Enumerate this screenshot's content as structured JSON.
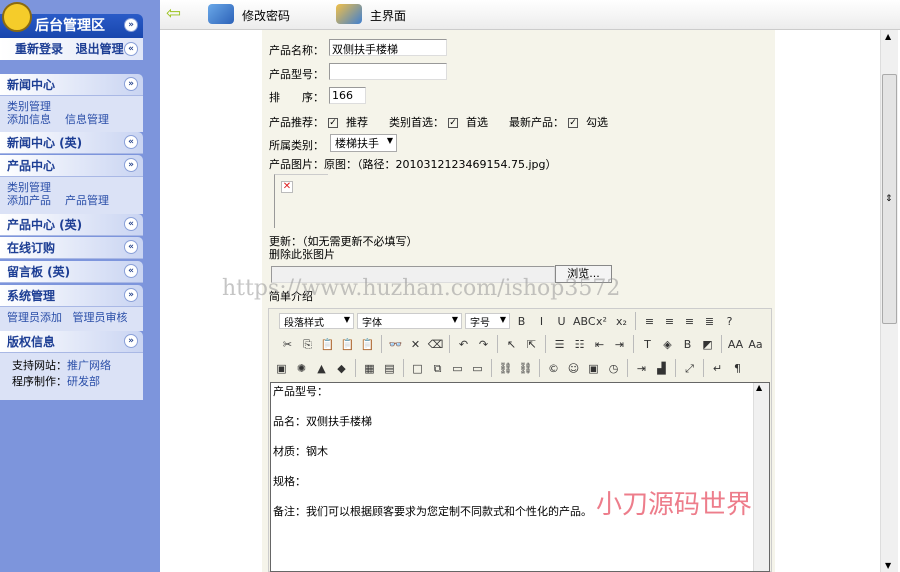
{
  "sidebar": {
    "title": "后台管理区",
    "relogin": "重新登录",
    "logout": "退出管理",
    "sections": [
      {
        "label": "新闻中心",
        "links": [
          "类别管理",
          "添加信息",
          "信息管理"
        ]
      },
      {
        "label": "新闻中心 (英)"
      },
      {
        "label": "产品中心",
        "links": [
          "类别管理",
          "添加产品",
          "产品管理"
        ]
      },
      {
        "label": "产品中心 (英)"
      },
      {
        "label": "在线订购"
      },
      {
        "label": "留言板 (英)"
      },
      {
        "label": "系统管理",
        "links": [
          "管理员添加",
          "管理员审核"
        ]
      },
      {
        "label": "版权信息",
        "links": [
          "支持网站：",
          "推广网络",
          "程序制作：",
          "研发部"
        ]
      }
    ]
  },
  "topbar": {
    "change_password": "修改密码",
    "main": "主界面"
  },
  "form": {
    "name_label": "产品名称：",
    "name_value": "双侧扶手楼梯",
    "model_label": "产品型号：",
    "model_value": "",
    "order_label": "排　　序：",
    "order_value": "166",
    "recommend_label": "产品推荐：",
    "recommend_opt": "推荐",
    "catfirst_label": "类别首选：",
    "catfirst_opt": "首选",
    "newest_label": "最新产品：",
    "newest_opt": "勾选",
    "category_label": "所属类别：",
    "category_value": "楼梯扶手",
    "image_label": "产品图片：原图：（路径：2010312123469154.75.jpg）",
    "update_label": "更新：（如无需更新不必填写）",
    "delete_label": "删除此张图片",
    "browse": "浏览...",
    "intro_label": "简单介绍"
  },
  "editor": {
    "paragraph_style": "段落样式",
    "font": "字体",
    "size": "字号",
    "content": [
      "产品型号：",
      "品名：双侧扶手楼梯",
      "材质：钢木",
      "规格：",
      "备注：我们可以根据顾客要求为您定制不同款式和个性化的产品。"
    ],
    "row1_icons": [
      [
        "bold-icon",
        "B"
      ],
      [
        "italic-icon",
        "I"
      ],
      [
        "underline-icon",
        "U"
      ],
      [
        "strikethrough-icon",
        "ABC"
      ],
      [
        "superscript-icon",
        "x²"
      ],
      [
        "subscript-icon",
        "x₂"
      ],
      [
        "sep",
        ""
      ],
      [
        "align-left-icon",
        "≡"
      ],
      [
        "align-center-icon",
        "≡"
      ],
      [
        "align-right-icon",
        "≡"
      ],
      [
        "justify-icon",
        "≣"
      ],
      [
        "help-icon",
        "?"
      ]
    ],
    "row2_icons": [
      [
        "cut-icon",
        "✂"
      ],
      [
        "copy-icon",
        "⎘"
      ],
      [
        "paste-icon",
        "📋"
      ],
      [
        "paste-text-icon",
        "📋"
      ],
      [
        "paste-word-icon",
        "📋"
      ],
      [
        "sep",
        ""
      ],
      [
        "find-icon",
        "👓"
      ],
      [
        "delete-icon",
        "✕"
      ],
      [
        "eraser-icon",
        "⌫"
      ],
      [
        "sep",
        ""
      ],
      [
        "undo-icon",
        "↶"
      ],
      [
        "redo-icon",
        "↷"
      ],
      [
        "sep",
        ""
      ],
      [
        "select-icon",
        "↖"
      ],
      [
        "select-all-icon",
        "⇱"
      ],
      [
        "sep",
        ""
      ],
      [
        "ordered-list-icon",
        "☰"
      ],
      [
        "unordered-list-icon",
        "☷"
      ],
      [
        "outdent-icon",
        "⇤"
      ],
      [
        "indent-icon",
        "⇥"
      ],
      [
        "sep",
        ""
      ],
      [
        "text-color-icon",
        "T"
      ],
      [
        "bg-color-icon",
        "◈"
      ],
      [
        "border-color-icon",
        "B"
      ],
      [
        "fill-icon",
        "◩"
      ],
      [
        "sep",
        ""
      ],
      [
        "font-larger-icon",
        "AA"
      ],
      [
        "font-smaller-icon",
        "Aa"
      ]
    ],
    "row3_icons": [
      [
        "image-icon",
        "▣"
      ],
      [
        "flash-icon",
        "✺"
      ],
      [
        "media-icon",
        "▲"
      ],
      [
        "anchor-icon",
        "◆"
      ],
      [
        "sep",
        ""
      ],
      [
        "table-icon",
        "▦"
      ],
      [
        "form-icon",
        "▤"
      ],
      [
        "sep",
        ""
      ],
      [
        "xml-icon",
        "□"
      ],
      [
        "template-icon",
        "⧉"
      ],
      [
        "hr-icon",
        "▭"
      ],
      [
        "marquee-icon",
        "▭"
      ],
      [
        "sep",
        ""
      ],
      [
        "link-icon",
        "⛓"
      ],
      [
        "unlink-icon",
        "⛓"
      ],
      [
        "sep",
        ""
      ],
      [
        "symbol-icon",
        "©"
      ],
      [
        "emoticon-icon",
        "☺"
      ],
      [
        "date-icon",
        "▣"
      ],
      [
        "time-icon",
        "◷"
      ],
      [
        "sep",
        ""
      ],
      [
        "import-icon",
        "⇥"
      ],
      [
        "stats-icon",
        "▟"
      ],
      [
        "sep",
        ""
      ],
      [
        "fullscreen-icon",
        "⤢"
      ],
      [
        "sep",
        ""
      ],
      [
        "br-icon",
        "↵"
      ],
      [
        "paragraph-icon",
        "¶"
      ]
    ]
  },
  "watermarks": {
    "url": "https://www.huzhan.com/ishop3572",
    "brand": "小刀源码世界"
  }
}
